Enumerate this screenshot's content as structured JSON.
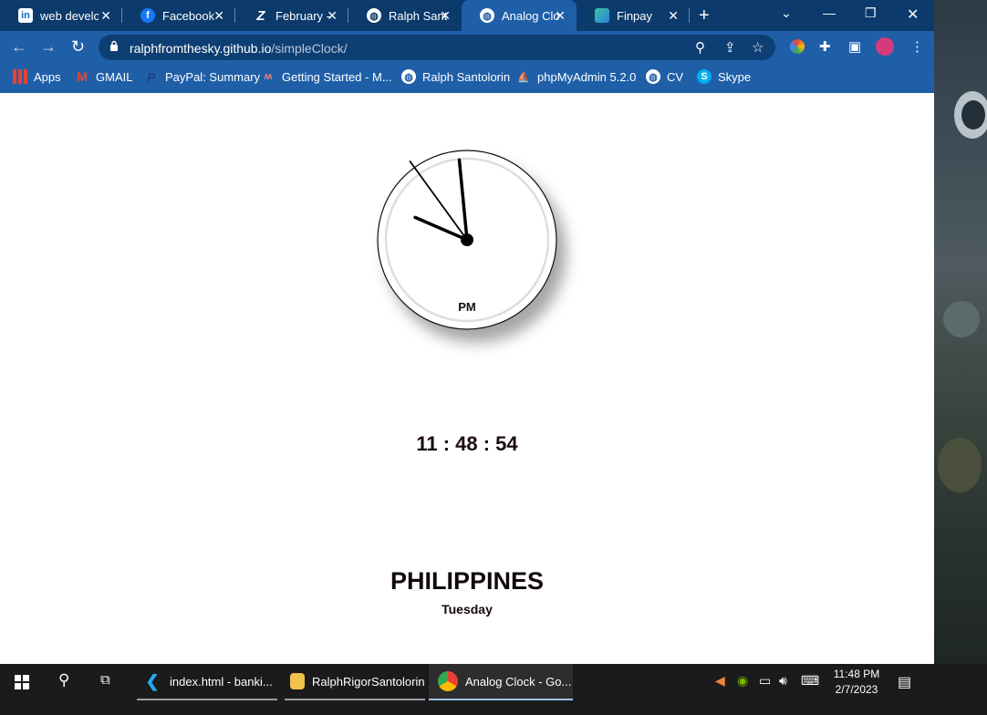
{
  "tabs": [
    {
      "title": "web develo",
      "icon": "linkedin-icon"
    },
    {
      "title": "Facebook",
      "icon": "facebook-icon"
    },
    {
      "title": "February - I",
      "icon": "february-site-icon"
    },
    {
      "title": "Ralph Santo",
      "icon": "globe-icon"
    },
    {
      "title": "Analog Clo",
      "icon": "globe-icon",
      "active": true
    },
    {
      "title": "Finpay",
      "icon": "finpay-icon"
    }
  ],
  "toolbar": {
    "url_host": "ralphfromthesky.github.io",
    "url_path": "/simpleClock/"
  },
  "bookmarks": [
    {
      "label": "Apps",
      "icon": "apps-grid-icon"
    },
    {
      "label": "GMAIL",
      "icon": "gmail-icon"
    },
    {
      "label": "PayPal: Summary",
      "icon": "paypal-icon"
    },
    {
      "label": "Getting Started - M...",
      "icon": "getting-started-icon"
    },
    {
      "label": "Ralph Santolorin",
      "icon": "globe-icon"
    },
    {
      "label": "phpMyAdmin 5.2.0",
      "icon": "phpmyadmin-icon"
    },
    {
      "label": "CV",
      "icon": "globe-icon"
    },
    {
      "label": "Skype",
      "icon": "skype-icon"
    }
  ],
  "clock": {
    "meridiem": "PM",
    "digital_time": "11 : 48 : 54",
    "hours": 11,
    "minutes": 48,
    "seconds": 54
  },
  "country": "PHILIPPINES",
  "day": "Tuesday",
  "taskbar": {
    "apps": [
      {
        "label": "index.html - banki...",
        "icon": "vscode-icon"
      },
      {
        "label": "RalphRigorSantolorin",
        "icon": "folder-icon"
      },
      {
        "label": "Analog Clock - Go...",
        "icon": "chrome-icon"
      }
    ],
    "time": "11:48 PM",
    "date": "2/7/2023"
  },
  "colors": {
    "tabstrip": "#0b3a6b",
    "toolbar": "#1f5fa8",
    "page_bg": "#ffffff",
    "taskbar": "#1b1b1b"
  }
}
